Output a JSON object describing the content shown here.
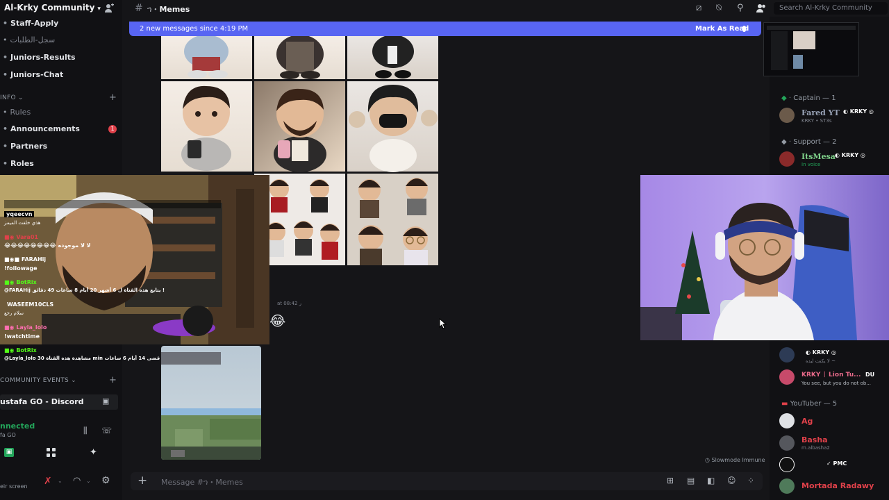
{
  "server": {
    "name": "Al-Krky Community",
    "chevron": "⌄",
    "add_icon": "person-add-icon"
  },
  "channels": {
    "staff_apply": "Staff-Apply",
    "arabic_requests": "سجل-الطلبات",
    "juniors_results": "Juniors-Results",
    "juniors_chat": "Juniors-Chat",
    "info_category": "INFO",
    "rules": "Rules",
    "announcements": "Announcements",
    "announcements_badge": "1",
    "partners": "Partners",
    "roles": "Roles",
    "community_events": "COMMUNITY EVENTS",
    "event_name": "ustafa GO - Discord"
  },
  "voice": {
    "status": "nnected",
    "channel": "fa GO",
    "share_label": "eir screen"
  },
  "topbar": {
    "channel": "Memes",
    "search_placeholder": "Search Al-Krky Community"
  },
  "banner": {
    "text": "2 new messages since 4:19 PM",
    "mark_read": "Mark As Read"
  },
  "message": {
    "timestamp": "at 08:42 ر",
    "emoji": "😂"
  },
  "slowmode": "Slowmode Immune",
  "composer": {
    "placeholder": "Message #ኀ・Memes"
  },
  "stream_chat": [
    {
      "user": "yqeecvn",
      "text": "هذي خلفت الميمز"
    },
    {
      "user": "Vara01",
      "text": "😂😂😂😂😂😂😂😂 لا لا موجوده"
    },
    {
      "user": "FARAHij",
      "text": "!followage"
    },
    {
      "user": "BotRix",
      "text": "@FARAHij يتابع هذه القناة ل 6 أشهر 20 أيام 8 ساعات 49 دقائق !"
    },
    {
      "user": "WASEEM10CLS",
      "text": "سلام رجع"
    },
    {
      "user": "Layla_lolo",
      "text": "!watchtime"
    },
    {
      "user": "BotRix",
      "text": "@Layla_lolo مشاهدة هذه القناة 30 min قضى 14 أيام 6 ساعات"
    }
  ],
  "members": {
    "captain_role": "Captain — 1",
    "captain": {
      "name": "Fared YT",
      "tag": "KRKY",
      "sub": "KRKY • ST3s"
    },
    "support_role": "Support — 2",
    "support": {
      "name": "ItsMesa",
      "tag": "KRKY",
      "sub": "In voice"
    },
    "krky_tag": "KRKY",
    "krky_sub": "لا يكنت ليده ~",
    "lion": {
      "name": "KRKY ᛁ Lion Tu...",
      "tag": "DU",
      "sub": "You see, but you do not ob..."
    },
    "youtuber_role": "YouTuber — 5",
    "yt1": "Ag",
    "yt2": {
      "name": "Basha",
      "sub": "m.albasha2"
    },
    "yt3_tag": "PMC",
    "yt4": "Mortada Radawy"
  },
  "colors": {
    "accent": "#5865f2",
    "bg": "#151518",
    "sidebar": "#111114",
    "mention": "#e0414a"
  }
}
